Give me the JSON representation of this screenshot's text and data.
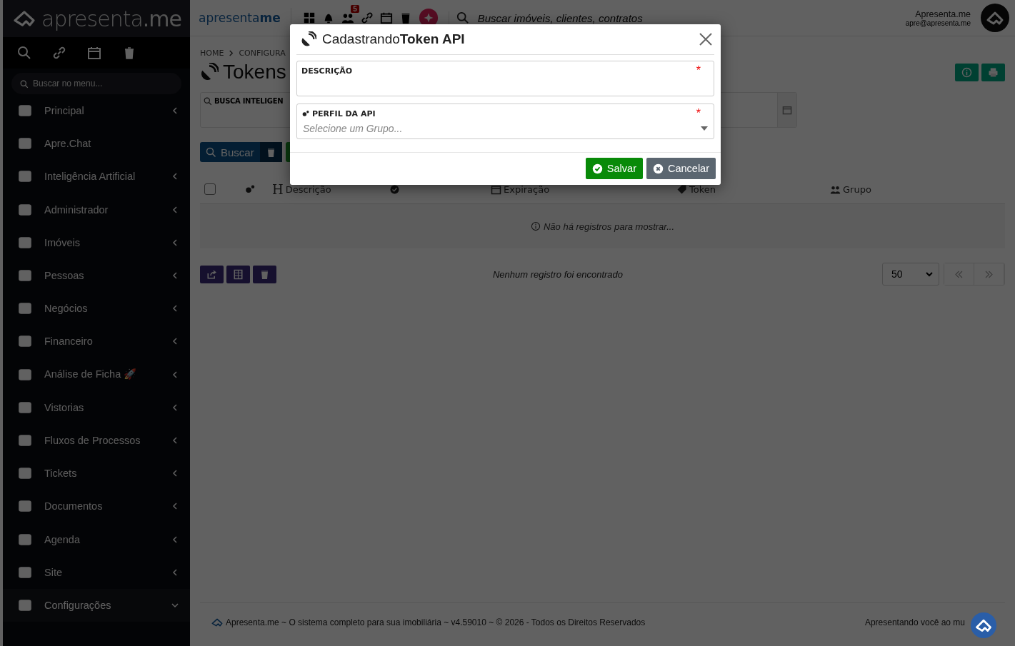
{
  "sidebar": {
    "logo": "apresenta**.me**",
    "menu_search": {
      "placeholder": "Buscar no menu..."
    },
    "items": [
      {
        "label": "Principal",
        "expanded": false
      },
      {
        "label": "Apre.Chat",
        "expanded": false,
        "no_chevron": true
      },
      {
        "label": "Inteligência Artificial",
        "expanded": false
      },
      {
        "label": "Administrador",
        "expanded": false
      },
      {
        "label": "Imóveis",
        "expanded": false
      },
      {
        "label": "Pessoas",
        "expanded": false
      },
      {
        "label": "Negócios",
        "expanded": false
      },
      {
        "label": "Financeiro",
        "expanded": false
      },
      {
        "label": "Análise de Ficha 🚀",
        "expanded": false
      },
      {
        "label": "Vistorias",
        "expanded": false
      },
      {
        "label": "Fluxos de Processos",
        "expanded": false
      },
      {
        "label": "Tickets",
        "expanded": false
      },
      {
        "label": "Documentos",
        "expanded": false
      },
      {
        "label": "Agenda",
        "expanded": false
      },
      {
        "label": "Site",
        "expanded": false
      },
      {
        "label": "Configurações",
        "expanded": true
      }
    ]
  },
  "topbar": {
    "logo": "apresenta**me**",
    "badge": "5",
    "search": {
      "placeholder": "Buscar imóveis, clientes, contratos"
    },
    "user_name": "Apresenta.me",
    "user_email": "apre@apresenta.me"
  },
  "breadcrumb": [
    "HOME",
    "CONFIGURA"
  ],
  "page_title": "Tokens",
  "filter": {
    "label": "BUSCA INTELIGEN"
  },
  "search_button": "Buscar",
  "table": {
    "select_all_checked": false,
    "heading_glyph": "H",
    "columns": [
      "",
      "",
      "Descrição",
      "",
      "Expiração",
      "Token",
      "Grupo"
    ],
    "empty_message": "Não há registros para mostrar..."
  },
  "pagination": {
    "status": "Nenhum registro foi encontrado",
    "page_size": "50"
  },
  "footer": {
    "text": "Apresenta.me ~ O sistema completo para sua imobiliária ~ v4.59010 ~ © 2026 - Todos os Direitos Reservados",
    "right": "Apresentando você ao mu"
  },
  "modal": {
    "title": "Cadastrando**Token API**",
    "required_mark": "*",
    "fields": [
      {
        "kind": "text",
        "label": "DESCRIÇÃO",
        "required": true
      },
      {
        "kind": "select",
        "label": "PERFIL DA API",
        "required": true,
        "placeholder": "Selecione um Grupo..."
      }
    ],
    "buttons": [
      {
        "kind": "primary",
        "label": "Salvar"
      },
      {
        "kind": "secondary",
        "label": "Cancelar"
      }
    ]
  }
}
